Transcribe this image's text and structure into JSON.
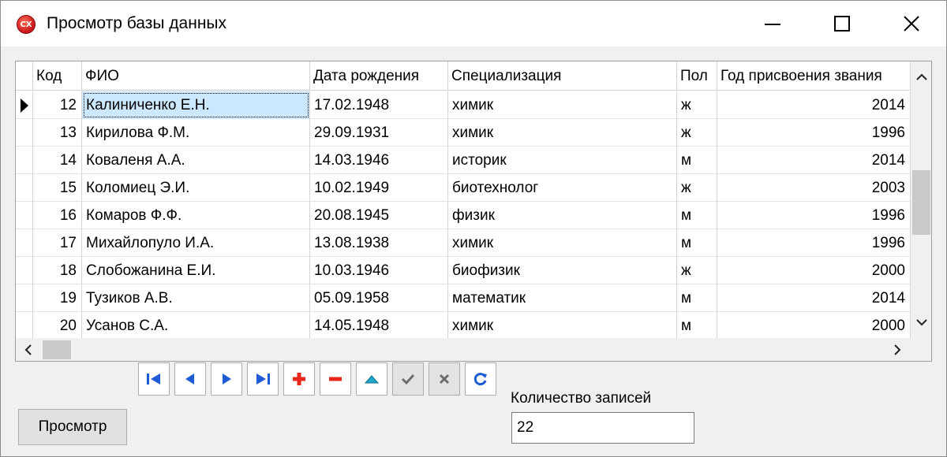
{
  "window": {
    "title": "Просмотр базы данных",
    "icon_text": "CX"
  },
  "grid": {
    "columns": [
      {
        "key": "code",
        "label": "Код"
      },
      {
        "key": "fio",
        "label": "ФИО"
      },
      {
        "key": "birth",
        "label": "Дата рождения"
      },
      {
        "key": "spec",
        "label": "Специализация"
      },
      {
        "key": "sex",
        "label": "Пол"
      },
      {
        "key": "year",
        "label": "Год присвоения звания"
      }
    ],
    "rows": [
      {
        "code": "12",
        "fio": "Калиниченко Е.Н.",
        "birth": "17.02.1948",
        "spec": "химик",
        "sex": "ж",
        "year": "2014"
      },
      {
        "code": "13",
        "fio": "Кирилова Ф.М.",
        "birth": "29.09.1931",
        "spec": "химик",
        "sex": "ж",
        "year": "1996"
      },
      {
        "code": "14",
        "fio": "Коваленя А.А.",
        "birth": "14.03.1946",
        "spec": "историк",
        "sex": "м",
        "year": "2014"
      },
      {
        "code": "15",
        "fio": "Коломиец Э.И.",
        "birth": "10.02.1949",
        "spec": "биотехнолог",
        "sex": "ж",
        "year": "2003"
      },
      {
        "code": "16",
        "fio": "Комаров Ф.Ф.",
        "birth": "20.08.1945",
        "spec": "физик",
        "sex": "м",
        "year": "1996"
      },
      {
        "code": "17",
        "fio": "Михайлопуло И.А.",
        "birth": "13.08.1938",
        "spec": "химик",
        "sex": "м",
        "year": "1996"
      },
      {
        "code": "18",
        "fio": "Слобожанина Е.И.",
        "birth": "10.03.1946",
        "spec": "биофизик",
        "sex": "ж",
        "year": "2000"
      },
      {
        "code": "19",
        "fio": "Тузиков А.В.",
        "birth": "05.09.1958",
        "spec": "математик",
        "sex": "м",
        "year": "2014"
      },
      {
        "code": "20",
        "fio": "Усанов С.А.",
        "birth": "14.05.1948",
        "spec": "химик",
        "sex": "м",
        "year": "2000"
      }
    ],
    "selected_row": 0
  },
  "navigator": {
    "buttons": [
      {
        "name": "first-record-button",
        "icon": "first-icon",
        "enabled": true
      },
      {
        "name": "prior-record-button",
        "icon": "prior-icon",
        "enabled": true
      },
      {
        "name": "next-record-button",
        "icon": "next-icon",
        "enabled": true
      },
      {
        "name": "last-record-button",
        "icon": "last-icon",
        "enabled": true
      },
      {
        "name": "insert-record-button",
        "icon": "plus-icon",
        "enabled": true
      },
      {
        "name": "delete-record-button",
        "icon": "minus-icon",
        "enabled": true
      },
      {
        "name": "edit-record-button",
        "icon": "triangle-up-icon",
        "enabled": true
      },
      {
        "name": "post-record-button",
        "icon": "check-icon",
        "enabled": false
      },
      {
        "name": "cancel-record-button",
        "icon": "cross-icon",
        "enabled": false
      },
      {
        "name": "refresh-records-button",
        "icon": "refresh-icon",
        "enabled": true
      }
    ]
  },
  "controls": {
    "view_button_label": "Просмотр",
    "count_label": "Количество записей",
    "count_value": "22"
  },
  "colors": {
    "nav_blue": "#1e5bd6",
    "nav_red": "#e8261b",
    "nav_teal": "#1ba8c9",
    "disabled_gray": "#6d6d6d",
    "selection": "#cce8ff"
  }
}
